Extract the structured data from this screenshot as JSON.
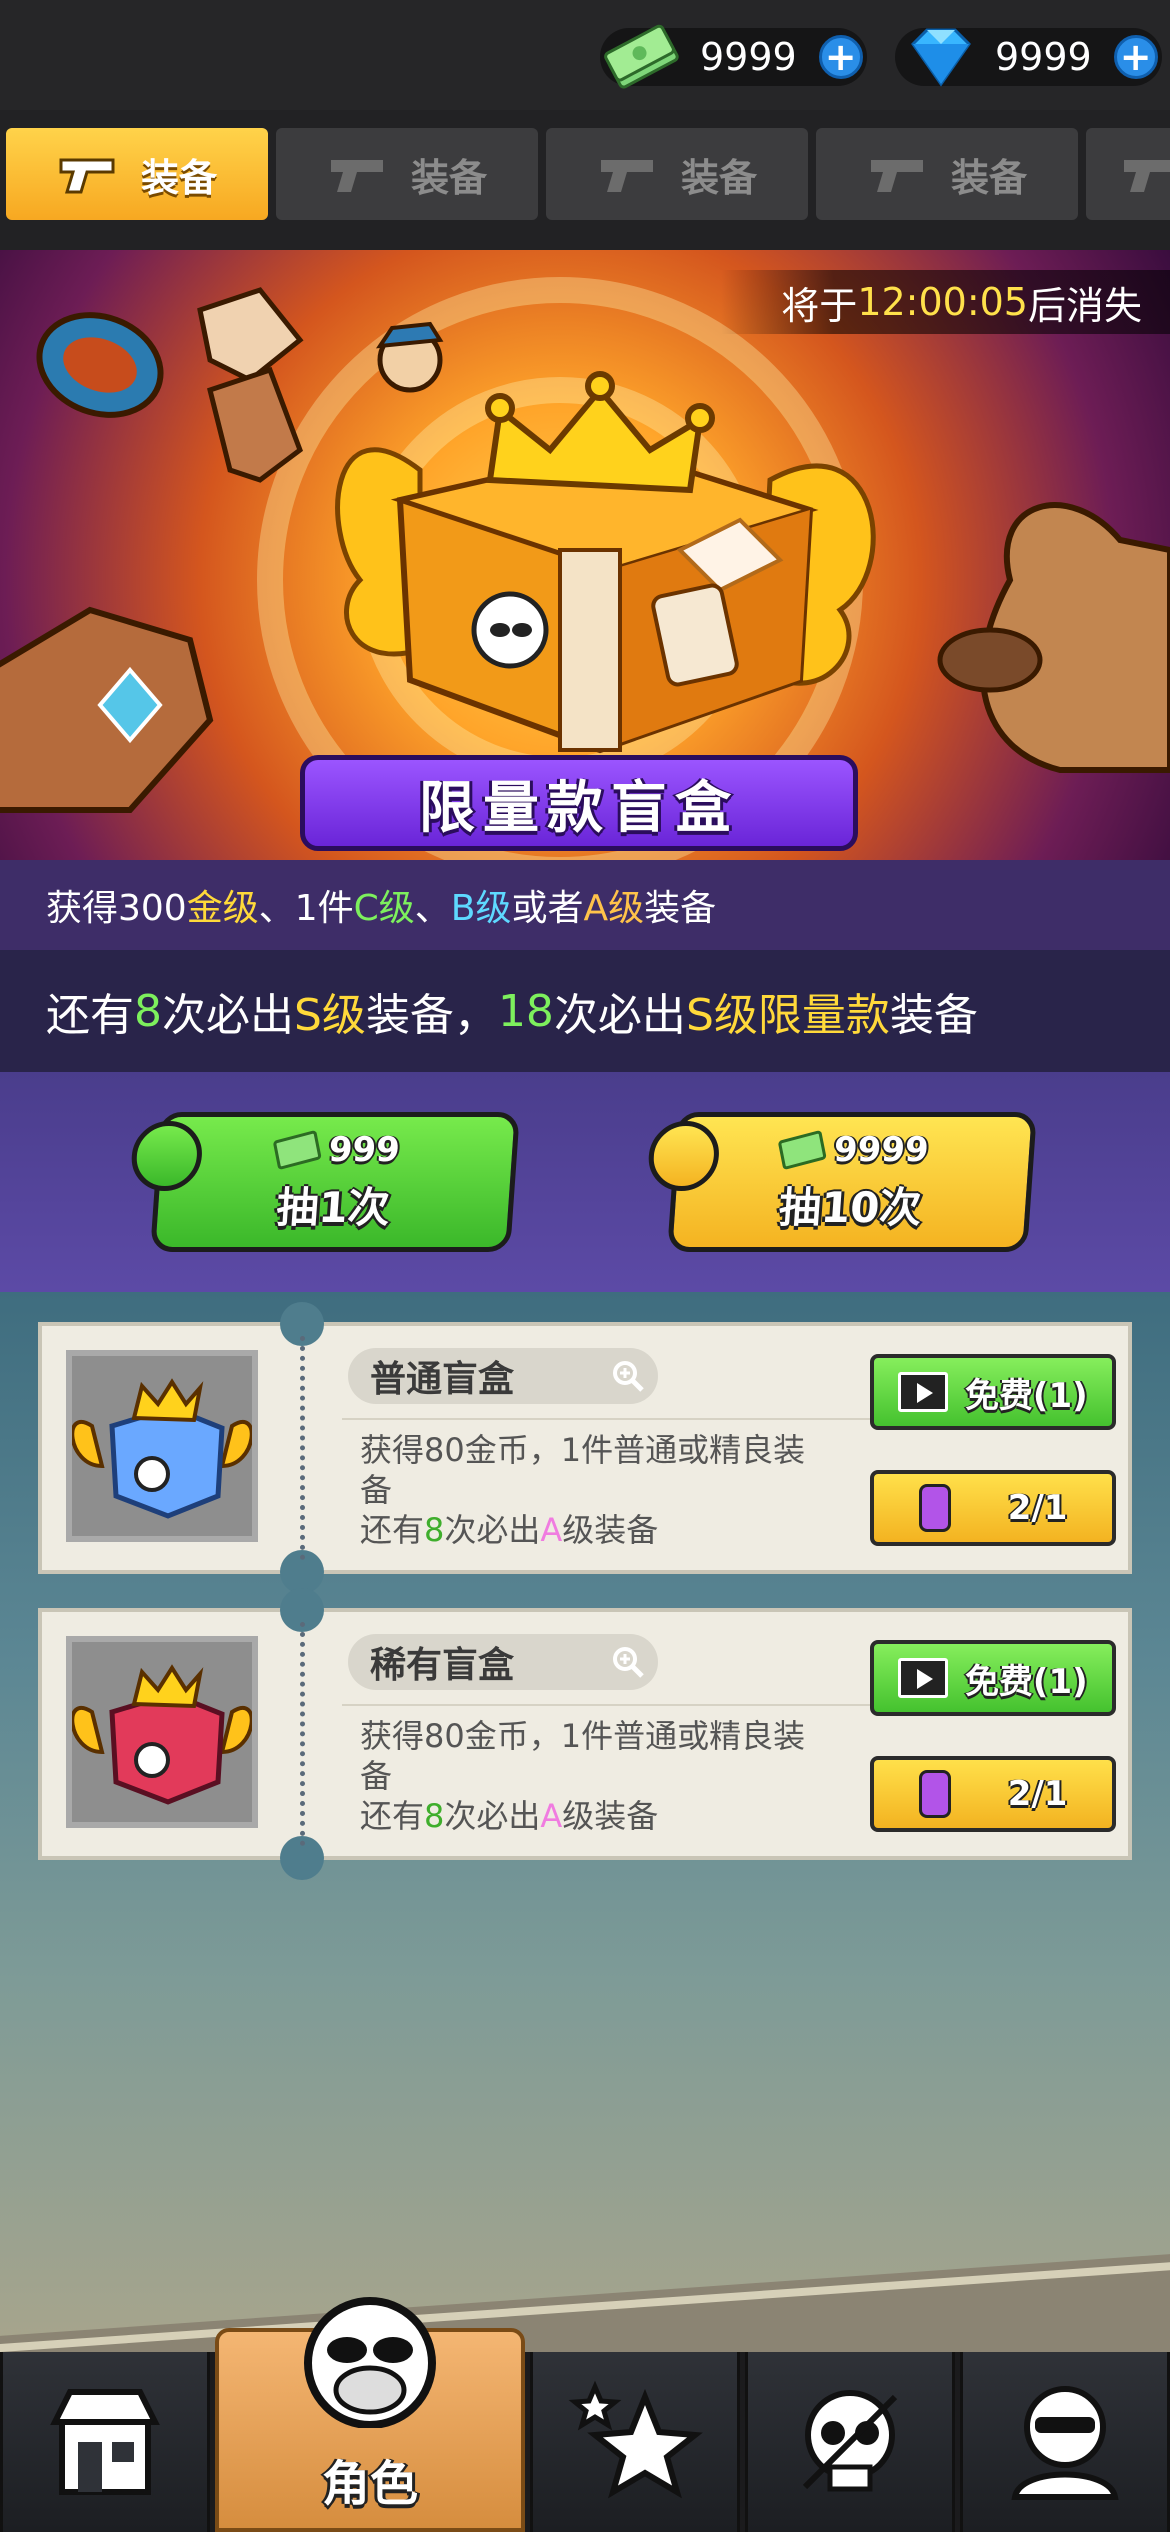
{
  "currency": {
    "cash_amount": "9999",
    "gem_amount": "9999",
    "cash_icon": "cash-stack-icon",
    "gem_icon": "blue-diamond-icon",
    "add_icon": "plus-icon"
  },
  "tabs": [
    {
      "label": "装备",
      "icon": "pistol-icon",
      "active": true
    },
    {
      "label": "装备",
      "icon": "pistol-icon",
      "active": false
    },
    {
      "label": "装备",
      "icon": "pistol-icon",
      "active": false
    },
    {
      "label": "装备",
      "icon": "pistol-icon",
      "active": false
    },
    {
      "label": "",
      "icon": "pistol-icon",
      "active": false
    }
  ],
  "banner": {
    "timer_prefix": "将于",
    "timer_value": "12:00:05",
    "timer_suffix": "后消失",
    "title": "限量款盲盒"
  },
  "info_line1": {
    "p1": "获得300",
    "gold": "金级",
    "p2": "、1件",
    "c": "C级",
    "p3": "、",
    "b": "B级",
    "p4": "或者",
    "a": "A级",
    "p5": "装备"
  },
  "info_line2": {
    "p1": "还有",
    "n1": "8",
    "p2": "次必出",
    "s1": "S级",
    "p3": "装备，",
    "n2": "18",
    "p4": "次必出",
    "s2": "S级限量款",
    "p5": "装备"
  },
  "draw_buttons": {
    "single": {
      "price": "999",
      "label": "抽1次"
    },
    "ten": {
      "price": "9999",
      "label": "抽10次"
    }
  },
  "boxes": [
    {
      "name": "普通盲盒",
      "desc_line1": "获得80金币，1件普通或精良装备",
      "desc_p1": "还有",
      "desc_n": "8",
      "desc_p2": "次必出",
      "desc_a": "A",
      "desc_p3": "级装备",
      "free_label": "免费(1)",
      "ticket_label": "2/1",
      "color": "#6aa8ff"
    },
    {
      "name": "稀有盲盒",
      "desc_line1": "获得80金币，1件普通或精良装备",
      "desc_p1": "还有",
      "desc_n": "8",
      "desc_p2": "次必出",
      "desc_a": "A",
      "desc_p3": "级装备",
      "free_label": "免费(1)",
      "ticket_label": "2/1",
      "color": "#e23a5a"
    }
  ],
  "nav": [
    {
      "icon": "shop-icon",
      "label": ""
    },
    {
      "icon": "monkey-face-icon",
      "label": "角色",
      "active": true
    },
    {
      "icon": "stars-icon",
      "label": ""
    },
    {
      "icon": "skull-icon",
      "label": ""
    },
    {
      "icon": "monkey-team-icon",
      "label": ""
    }
  ]
}
